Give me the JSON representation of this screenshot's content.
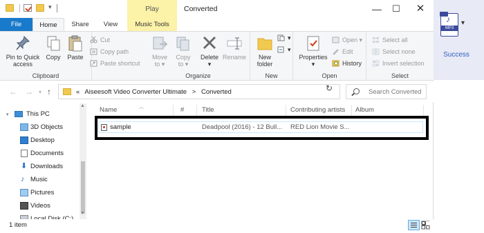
{
  "window": {
    "title": "Converted",
    "context_tab": "Play",
    "minimize": "—",
    "maximize": "☐",
    "close": "✕"
  },
  "ribbon_tabs": [
    "File",
    "Home",
    "Share",
    "View",
    "Music Tools"
  ],
  "ribbon": {
    "clipboard": {
      "pin_line1": "Pin to Quick",
      "pin_line2": "access",
      "copy": "Copy",
      "paste": "Paste",
      "cut": "Cut",
      "copy_path": "Copy path",
      "paste_shortcut": "Paste shortcut",
      "group": "Clipboard"
    },
    "organize": {
      "move_to": "Move",
      "move_to2": "to ▾",
      "copy_to": "Copy",
      "copy_to2": "to ▾",
      "delete": "Delete",
      "delete2": "▾",
      "rename": "Rename",
      "group": "Organize"
    },
    "new": {
      "new_folder": "New",
      "new_folder2": "folder",
      "group": "New"
    },
    "open": {
      "properties": "Properties",
      "properties2": "▾",
      "open": "Open ▾",
      "edit": "Edit",
      "history": "History",
      "group": "Open"
    },
    "select": {
      "select_all": "Select all",
      "select_none": "Select none",
      "invert": "Invert selection",
      "group": "Select"
    }
  },
  "address": {
    "prefix": "«",
    "crumbs": [
      "Aiseesoft Video Converter Ultimate",
      ">",
      "Converted"
    ],
    "search_placeholder": "Search Converted"
  },
  "nav_pane": {
    "items": [
      "This PC",
      "3D Objects",
      "Desktop",
      "Documents",
      "Downloads",
      "Music",
      "Pictures",
      "Videos",
      "Local Disk (C:)"
    ]
  },
  "file_list": {
    "columns": [
      "Name",
      "#",
      "Title",
      "Contributing artists",
      "Album"
    ],
    "rows": [
      {
        "name": "sample",
        "number": "",
        "title": "Deadpool (2016) - 12 Bull...",
        "artists": "RED Lion Movie S...",
        "album": ""
      }
    ]
  },
  "status": {
    "item_count": "1 item"
  },
  "side_panel": {
    "icon_label": "MP3",
    "status": "Success"
  }
}
